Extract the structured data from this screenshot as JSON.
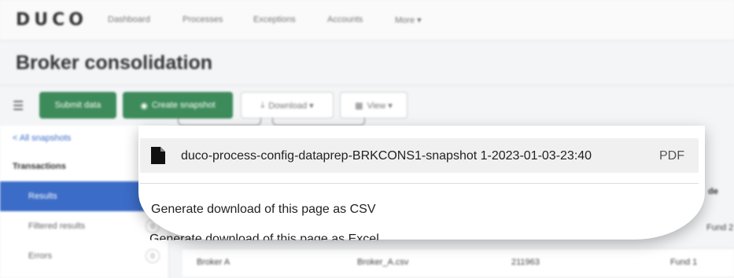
{
  "nav": {
    "logo": "DUCO",
    "links": [
      "Dashboard",
      "Processes",
      "Exceptions",
      "Accounts",
      "More ▾"
    ]
  },
  "page": {
    "title": "Broker consolidation"
  },
  "toolbar": {
    "submit_label": "Submit data",
    "snapshot_label": "Create snapshot",
    "download_label": "Download ▾",
    "view_label": "View ▾"
  },
  "sidebar": {
    "back_link": "< All snapshots",
    "section": "Transactions",
    "items": [
      {
        "label": "Results",
        "count": "",
        "active": true
      },
      {
        "label": "Filtered results",
        "count": "0"
      },
      {
        "label": "Errors",
        "count": "0"
      }
    ]
  },
  "table": {
    "header_partial": "de",
    "row2_fund": "Fund 2",
    "row": {
      "broker": "Broker A",
      "file": "Broker_A.csv",
      "id": "211963",
      "fund": "Fund 1"
    }
  },
  "download_menu": {
    "pdf_item": {
      "name": "duco-process-config-dataprep-BRKCONS1-snapshot 1-2023-01-03-23:40",
      "type": "PDF"
    },
    "options": [
      "Generate download of this page as CSV",
      "Generate download of this page as Excel"
    ]
  },
  "colors": {
    "primary_green": "#3d8b5a",
    "accent_blue": "#3b6cc7"
  }
}
